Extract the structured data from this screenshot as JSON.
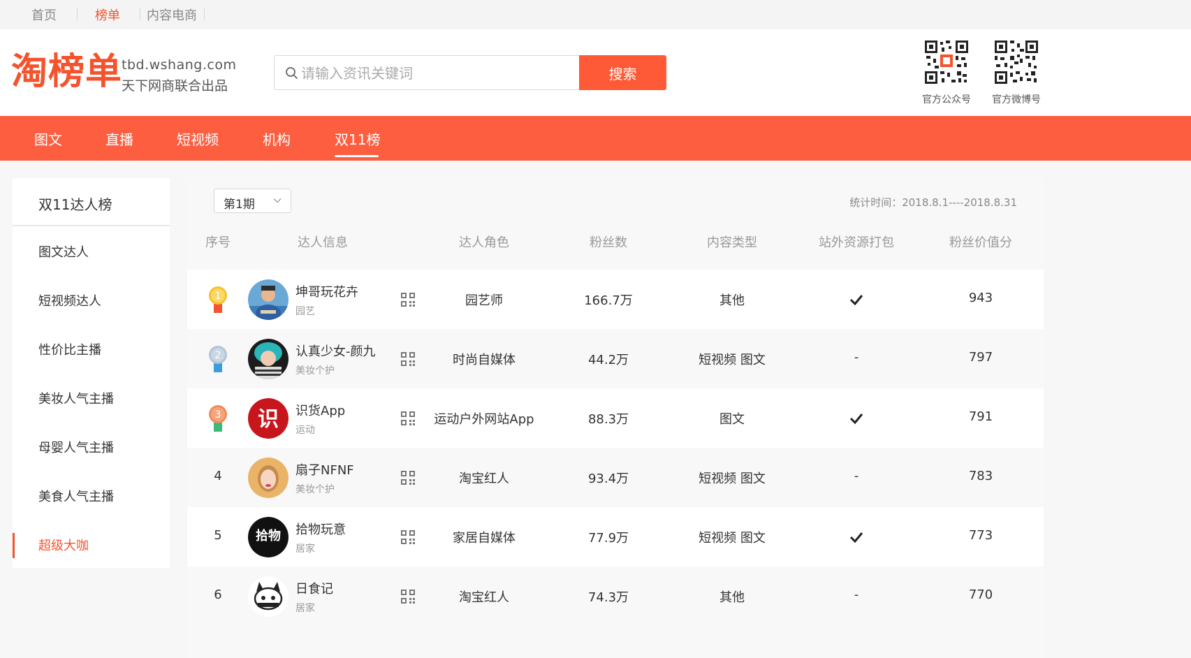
{
  "top_links": [
    "首页",
    "榜单",
    "内容电商"
  ],
  "header": {
    "logo_text": "淘榜单",
    "domain": "tbd.wshang.com",
    "slogan": "天下网商联合出品",
    "search_placeholder": "请输入资讯关键词",
    "search_button": "搜索",
    "qr_captions": [
      "官方公众号",
      "官方微博号"
    ]
  },
  "nav": {
    "items": [
      "图文",
      "直播",
      "短视频",
      "机构",
      "双11榜"
    ],
    "active": "双11榜"
  },
  "sidebar": {
    "title": "双11达人榜",
    "items": [
      "图文达人",
      "短视频达人",
      "性价比主播",
      "美妆人气主播",
      "母婴人气主播",
      "美食人气主播",
      "超级大咖"
    ],
    "active": "超级大咖"
  },
  "main": {
    "period": "第1期",
    "stat_time": "统计时间：2018.8.1----2018.8.31",
    "columns": [
      "序号",
      "达人信息",
      "达人角色",
      "粉丝数",
      "内容类型",
      "站外资源打包",
      "粉丝价值分"
    ],
    "rows": [
      {
        "rank": "1",
        "name": "坤哥玩花卉",
        "category": "园艺",
        "role": "园艺师",
        "fans": "166.7万",
        "content": "其他",
        "pack": true,
        "score": "943"
      },
      {
        "rank": "2",
        "name": "认真少女-颜九",
        "category": "美妆个护",
        "role": "时尚自媒体",
        "fans": "44.2万",
        "content": "短视频 图文",
        "pack": false,
        "score": "797"
      },
      {
        "rank": "3",
        "name": "识货App",
        "category": "运动",
        "role": "运动户外网站App",
        "fans": "88.3万",
        "content": "图文",
        "pack": true,
        "score": "791"
      },
      {
        "rank": "4",
        "name": "扇子NFNF",
        "category": "美妆个护",
        "role": "淘宝红人",
        "fans": "93.4万",
        "content": "短视频 图文",
        "pack": false,
        "score": "783"
      },
      {
        "rank": "5",
        "name": "拾物玩意",
        "category": "居家",
        "role": "家居自媒体",
        "fans": "77.9万",
        "content": "短视频 图文",
        "pack": true,
        "score": "773"
      },
      {
        "rank": "6",
        "name": "日食记",
        "category": "居家",
        "role": "淘宝红人",
        "fans": "74.3万",
        "content": "其他",
        "pack": false,
        "score": "770"
      }
    ],
    "pack_no": "-"
  },
  "avatar_glyphs": {
    "row3": "识",
    "row5": "拾物"
  },
  "colors": {
    "brand": "#fe5e40",
    "active_text": "#f4532d",
    "gold": "#f6c12e",
    "silver": "#b3c4d6",
    "bronze": "#f08b5b"
  }
}
